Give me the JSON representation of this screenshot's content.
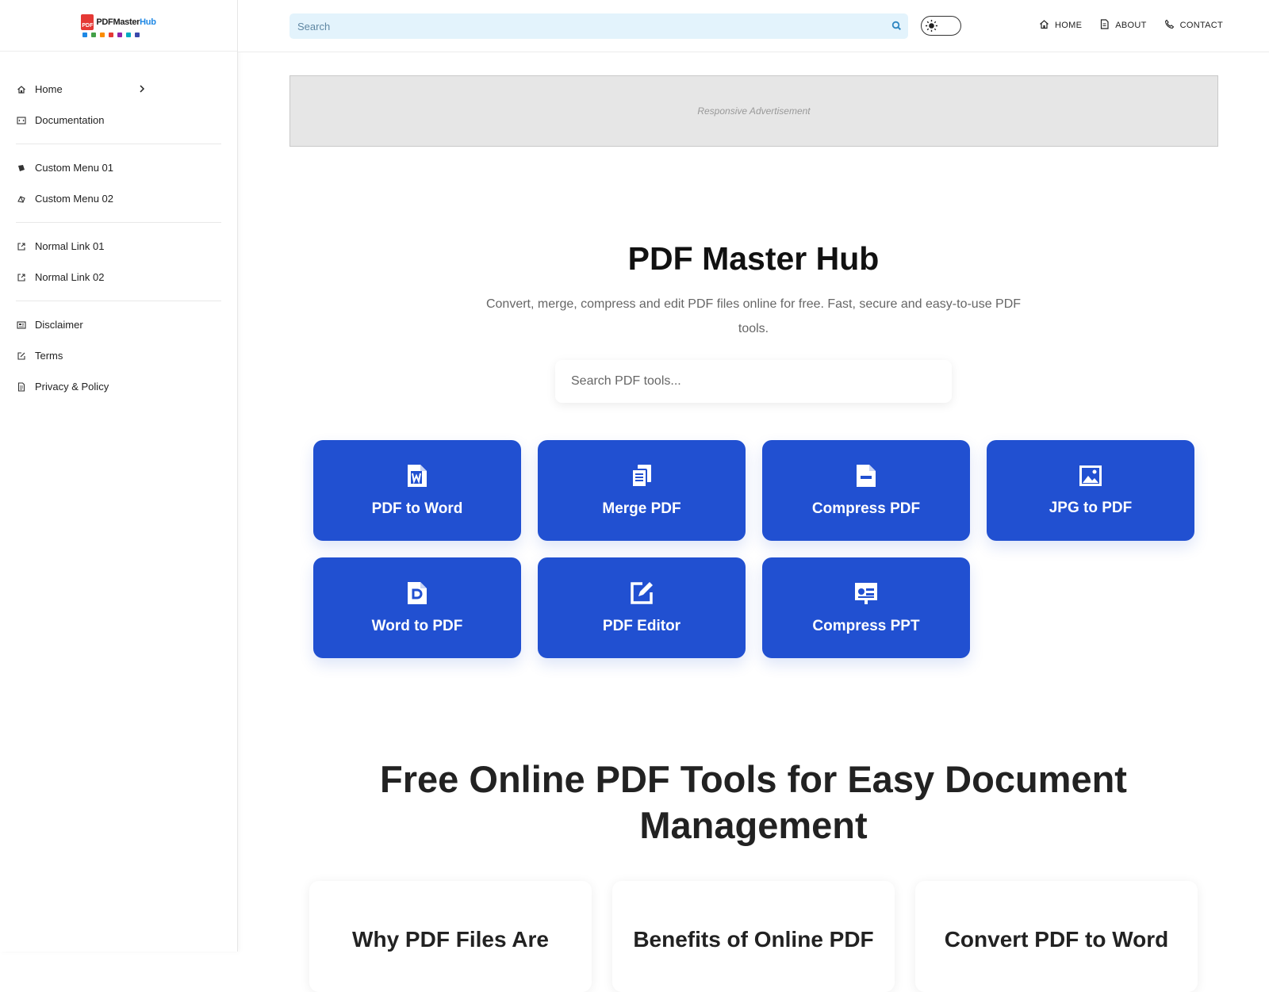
{
  "brand": {
    "logo_main": "PDFMaster",
    "logo_accent": "Hub",
    "logo_badge": "PDF",
    "colors": {
      "primary": "#2150d1",
      "logo_red": "#e53935",
      "logo_blue": "#1e88e5"
    }
  },
  "sidebar": {
    "groups": [
      {
        "items": [
          {
            "label": "Home",
            "icon": "home-icon",
            "has_chevron": true
          },
          {
            "label": "Documentation",
            "icon": "code-icon"
          }
        ]
      },
      {
        "items": [
          {
            "label": "Custom Menu 01",
            "icon": "book-icon"
          },
          {
            "label": "Custom Menu 02",
            "icon": "layers-icon"
          }
        ]
      },
      {
        "items": [
          {
            "label": "Normal Link 01",
            "icon": "external-link-icon"
          },
          {
            "label": "Normal Link 02",
            "icon": "external-link-icon"
          }
        ]
      },
      {
        "items": [
          {
            "label": "Disclaimer",
            "icon": "news-icon"
          },
          {
            "label": "Terms",
            "icon": "edit-icon"
          },
          {
            "label": "Privacy & Policy",
            "icon": "document-icon"
          }
        ]
      }
    ]
  },
  "header": {
    "search_placeholder": "Search",
    "nav": [
      {
        "label": "HOME",
        "icon": "home-icon"
      },
      {
        "label": "ABOUT",
        "icon": "document-icon"
      },
      {
        "label": "CONTACT",
        "icon": "phone-icon"
      }
    ]
  },
  "ad": {
    "label": "Responsive Advertisement"
  },
  "hero": {
    "title": "PDF Master Hub",
    "subtitle": "Convert, merge, compress and edit PDF files online for free. Fast, secure and easy-to-use PDF tools.",
    "search_placeholder": "Search PDF tools..."
  },
  "tools": [
    {
      "label": "PDF to Word",
      "icon": "file-word-icon"
    },
    {
      "label": "Merge PDF",
      "icon": "copy-files-icon"
    },
    {
      "label": "Compress PDF",
      "icon": "file-minus-icon"
    },
    {
      "label": "JPG to PDF",
      "icon": "image-icon"
    },
    {
      "label": "Word to PDF",
      "icon": "file-pdf-icon"
    },
    {
      "label": "PDF Editor",
      "icon": "pen-square-icon"
    },
    {
      "label": "Compress PPT",
      "icon": "presentation-icon"
    }
  ],
  "section": {
    "title": "Free Online PDF Tools for Easy Document Management",
    "cards": [
      {
        "title": "Why PDF Files Are"
      },
      {
        "title": "Benefits of Online PDF"
      },
      {
        "title": "Convert PDF to Word"
      }
    ]
  }
}
